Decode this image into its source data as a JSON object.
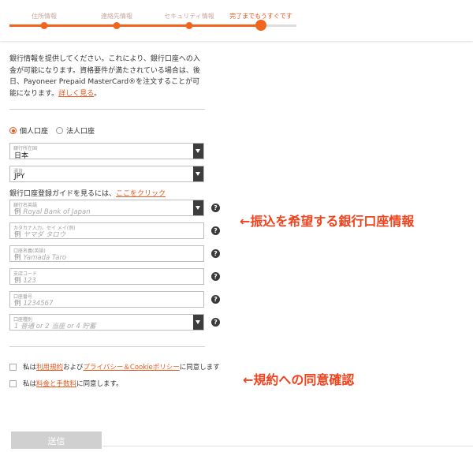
{
  "progress": {
    "steps": [
      "住所情報",
      "連絡先情報",
      "セキュリティ情報",
      "完了までもうすぐです"
    ],
    "current_step": 4,
    "fill_fraction": 0.87,
    "accent": "#f0661f"
  },
  "intro": {
    "text": "銀行情報を提供してください。これにより、銀行口座への入金が可能になります。資格要件が満たされている場合は、後日、Payoneer Prepaid MasterCard®を注文することが可能になります。",
    "link": "詳しく見る",
    "tail": "。"
  },
  "account_type": {
    "personal": "個人口座",
    "business": "法人口座",
    "selected": "個人口座"
  },
  "fields": {
    "country": {
      "label": "銀行所在国",
      "value": "日本"
    },
    "currency": {
      "label": "通貨",
      "value": "JPY"
    },
    "bank_name": {
      "label": "銀行名英語",
      "prefix": "例",
      "placeholder": "Royal Bank of Japan"
    },
    "holder_kana": {
      "label": "カタカナ入力。セイ メイ(例)",
      "prefix": "例",
      "placeholder": "ヤマダ タロウ"
    },
    "holder_en": {
      "label": "口座名義(英語)",
      "prefix": "例",
      "placeholder": "Yamada Taro"
    },
    "branch_code": {
      "label": "支店コード",
      "prefix": "例",
      "placeholder": "123"
    },
    "account_number": {
      "label": "口座番号",
      "prefix": "例",
      "placeholder": "1234567"
    },
    "account_kind": {
      "label": "口座種別",
      "placeholder": "1 普通 or 2 当座 or 4 貯蓄"
    }
  },
  "guide": {
    "text": "銀行口座登録ガイドを見るには、",
    "link": "ここをクリック"
  },
  "help_glyph": "?",
  "annotations": {
    "bank_info": "←振込を希望する銀行口座情報",
    "consent": "←規約への同意確認"
  },
  "terms": {
    "line1": {
      "a": "私は",
      "link1": "利用規約",
      "b": "および",
      "link2": "プライバシー＆Cookieポリシー",
      "c": "に同意します"
    },
    "line2": {
      "a": "私は",
      "link1": "料金と手数料",
      "b": "に同意します。"
    }
  },
  "submit_label": "送信"
}
